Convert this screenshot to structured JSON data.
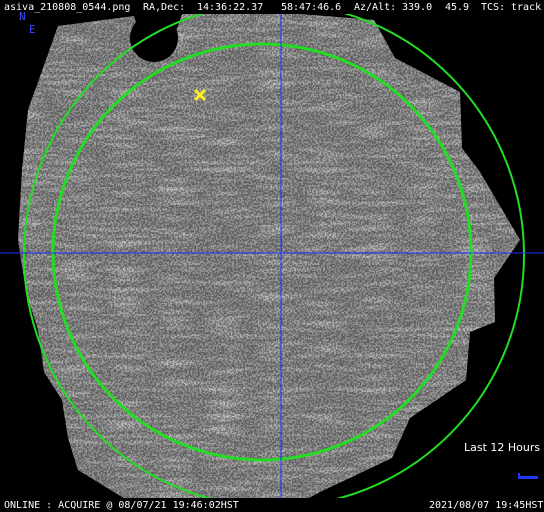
{
  "header": {
    "filename": "asiva_210808_0544.png",
    "radec_label": "RA,Dec:",
    "ra": "14:36:22.37",
    "dec": "58:47:46.6",
    "azalt_label": "Az/Alt:",
    "az": "339.0",
    "alt": "45.9",
    "tcs_label": "TCS:",
    "tcs_state": "track"
  },
  "orientation": {
    "north": "N",
    "east": "E"
  },
  "legend": {
    "label": "Last 12 Hours"
  },
  "footer": {
    "status": "ONLINE : ACQUIRE @ 08/07/21 19:46:02HST",
    "timestamp": "2021/08/07 19:45HST"
  },
  "colors": {
    "background": "#000000",
    "text": "#ffffff",
    "crosshair": "#1f2dff",
    "airmass_circle": "#22dd22",
    "horizon_circle": "#22dd22",
    "target_marker": "#ffee22",
    "direction_labels": "#3b4bff"
  },
  "markers": {
    "target_icon": "x-marker-icon"
  }
}
